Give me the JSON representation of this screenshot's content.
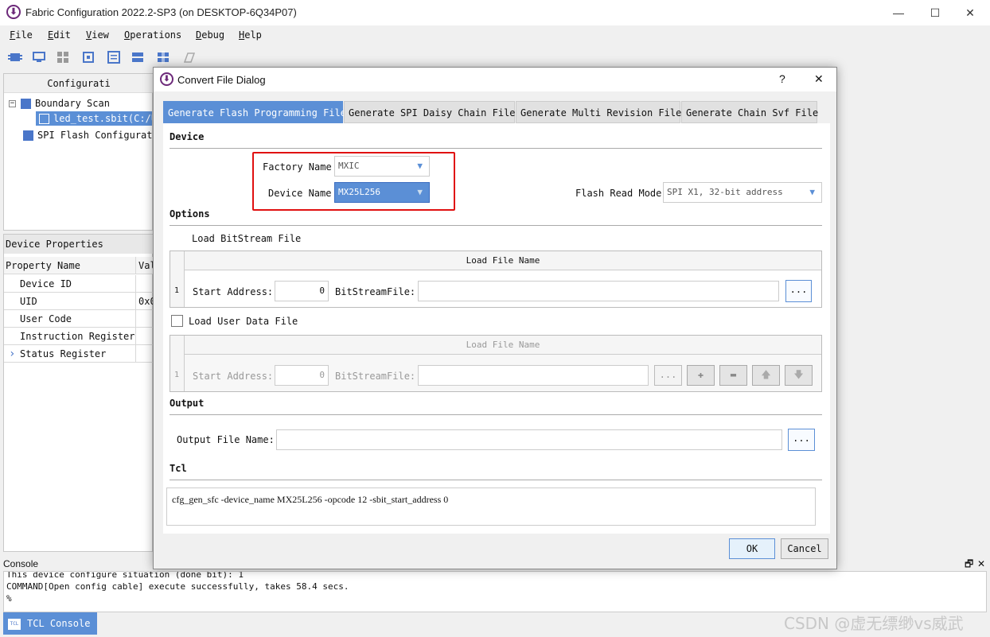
{
  "window": {
    "title": "Fabric Configuration 2022.2-SP3 (on DESKTOP-6Q34P07)",
    "app_icon_glyph": "⬇",
    "minimize": "—",
    "maximize": "☐",
    "close": "✕"
  },
  "menu": {
    "file": "File",
    "edit": "Edit",
    "view": "View",
    "operations": "Operations",
    "debug": "Debug",
    "help": "Help"
  },
  "toolbar": {
    "icons": [
      "chip-scan-icon",
      "monitor-icon",
      "grid-icon",
      "chip-icon",
      "list-icon",
      "chain-icon",
      "flash-chain-icon",
      "eraser-icon"
    ],
    "accent_color": "#4a76c9"
  },
  "config_panel": {
    "header": "Configurati",
    "tree": {
      "boundary_scan": "Boundary Scan",
      "bitstream_file": "led_test.sbit(C:/U",
      "spi_flash": "SPI Flash Configurati"
    }
  },
  "device_properties": {
    "header": "Device Properties",
    "col_name": "Property Name",
    "col_value": "Val",
    "rows": [
      {
        "name": "Device ID",
        "value": ""
      },
      {
        "name": "UID",
        "value": "0x0"
      },
      {
        "name": "User Code",
        "value": ""
      },
      {
        "name": "Instruction Register",
        "value": ""
      },
      {
        "name": "Status Register",
        "value": ""
      }
    ],
    "expand_glyph": "›"
  },
  "console": {
    "title": "Console",
    "float_glyph": "🗗",
    "close_glyph": "✕",
    "lines": [
      "This device configure situation (done bit): 1",
      "COMMAND[Open config cable] execute successfully, takes 58.4 secs.",
      "%"
    ],
    "tab_label": "TCL Console",
    "tab_icon_text": "TCL"
  },
  "watermark": "CSDN @虚无缥缈vs威武",
  "dialog": {
    "title": "Convert File Dialog",
    "help": "?",
    "close": "✕",
    "tabs": [
      "Generate Flash Programming File",
      "Generate SPI Daisy Chain File",
      "Generate Multi Revision File",
      "Generate Chain Svf File"
    ],
    "device": {
      "title": "Device",
      "factory_label": "Factory Name",
      "factory_value": "MXIC",
      "device_label": "Device Name",
      "device_value": "MX25L256",
      "flash_read_label": "Flash Read Mode",
      "flash_read_value": "SPI X1, 32-bit address"
    },
    "options": {
      "title": "Options",
      "load_bitstream_label": "Load BitStream File",
      "grid_header": "Load File Name",
      "row_num": "1",
      "start_address_label": "Start Address:",
      "start_address_value": "0",
      "bitstream_label": "BitStreamFile:",
      "browse": "...",
      "load_user_data_label": "Load User Data File",
      "user_grid_header": "Load File Name",
      "user_row_num": "1",
      "user_start_address_label": "Start Address:",
      "user_start_address_value": "0",
      "user_bitstream_label": "BitStreamFile:",
      "user_browse": "...",
      "add_glyph": "✚",
      "remove_glyph": "▬",
      "up_glyph": "🡅",
      "down_glyph": "🡇"
    },
    "output": {
      "title": "Output",
      "file_label": "Output File Name:",
      "file_value": "",
      "browse": "..."
    },
    "tcl": {
      "title": "Tcl",
      "command": "cfg_gen_sfc -device_name MX25L256 -opcode 12 -sbit_start_address 0"
    },
    "ok": "OK",
    "cancel": "Cancel",
    "highlight_color": "#e01010"
  }
}
